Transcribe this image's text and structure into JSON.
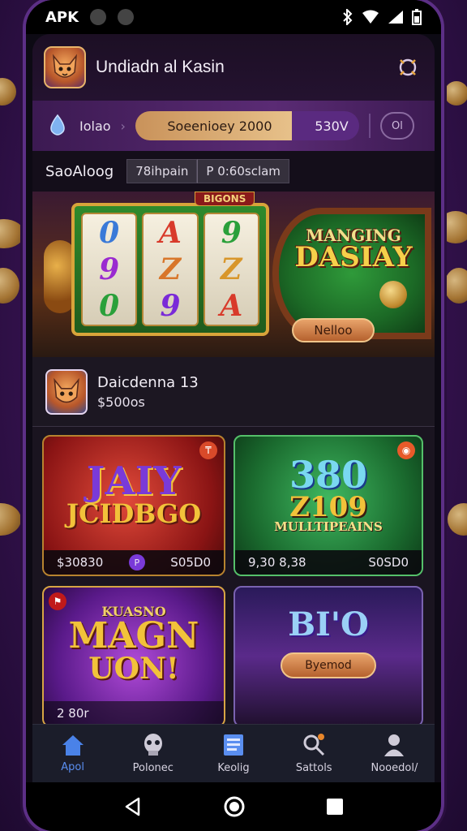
{
  "status_bar": {
    "carrier": "APK"
  },
  "header": {
    "title": "Undiadn al Kasin"
  },
  "topbar": {
    "location_label": "Iolao",
    "promo_label": "Soeenioey 2000",
    "promo_value": "530V",
    "mini_label": "Ol"
  },
  "section": {
    "title": "SaoAloog",
    "chip_1": "78ihpain",
    "chip_2": "P 0:60sclam"
  },
  "banner": {
    "tag": "BIGONS",
    "title_line1": "MANGING",
    "title_line2": "DASIAY",
    "button_label": "Nelloo",
    "reels": [
      [
        "0",
        "9",
        "0"
      ],
      [
        "A",
        "Z",
        "9"
      ],
      [
        "9",
        "Z",
        "A"
      ]
    ]
  },
  "profile": {
    "name": "Daicdenna 13",
    "balance": "$500os"
  },
  "cards": [
    {
      "title_1": "JAIY",
      "title_2": "JCIDBGO",
      "badge": "P",
      "left": "$30830",
      "right": "S05D0"
    },
    {
      "title_1": "380",
      "title_2": "Z109",
      "title_3": "MULLTIPEAINS",
      "left": "9,30 8,38",
      "right": "S0SD0"
    },
    {
      "title_1": "KUASNO",
      "title_2": "MAGN",
      "title_3": "UON!",
      "left": "2 80r",
      "right": ""
    },
    {
      "title_1": "BI'O",
      "button": "Byemod",
      "left": "",
      "right": ""
    }
  ],
  "tabs": [
    {
      "label": "Apol",
      "icon": "home-icon"
    },
    {
      "label": "Polonec",
      "icon": "mask-icon"
    },
    {
      "label": "Keolig",
      "icon": "news-icon"
    },
    {
      "label": "Sattols",
      "icon": "search-icon"
    },
    {
      "label": "Nooedol/",
      "icon": "profile-icon"
    }
  ],
  "colors": {
    "accent": "#5a8ef0",
    "gold": "#d8a43a",
    "purple": "#5a2b74"
  }
}
